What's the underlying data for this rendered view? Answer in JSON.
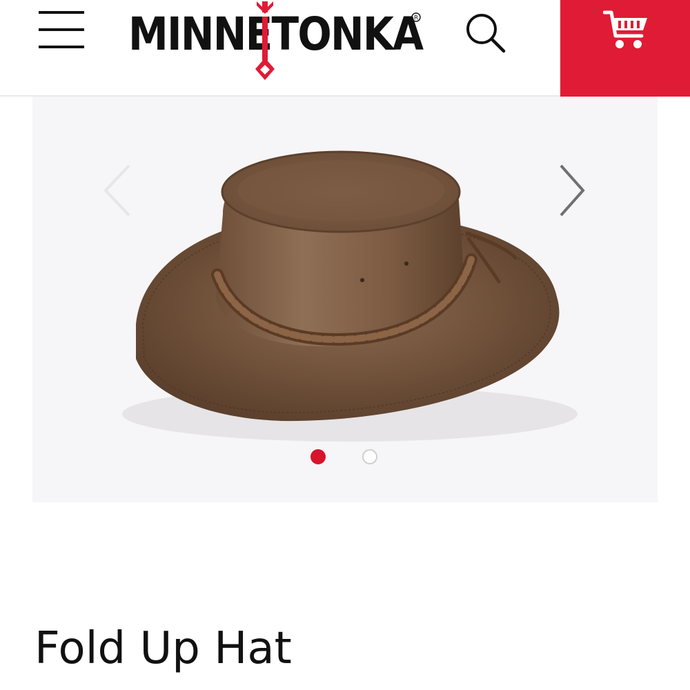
{
  "header": {
    "logo_text": "MINNETONKA",
    "registered_mark": "®",
    "menu_icon": "hamburger-menu-icon",
    "search_icon": "search-icon",
    "cart_icon": "cart-icon",
    "cart_color": "#e01b35",
    "brand_red": "#d7142c"
  },
  "gallery": {
    "image_alt": "Fold Up Hat",
    "prev_icon": "chevron-left-icon",
    "next_icon": "chevron-right-icon",
    "slide_count": 2,
    "active_slide": 1
  },
  "product": {
    "title": "Fold Up Hat"
  }
}
